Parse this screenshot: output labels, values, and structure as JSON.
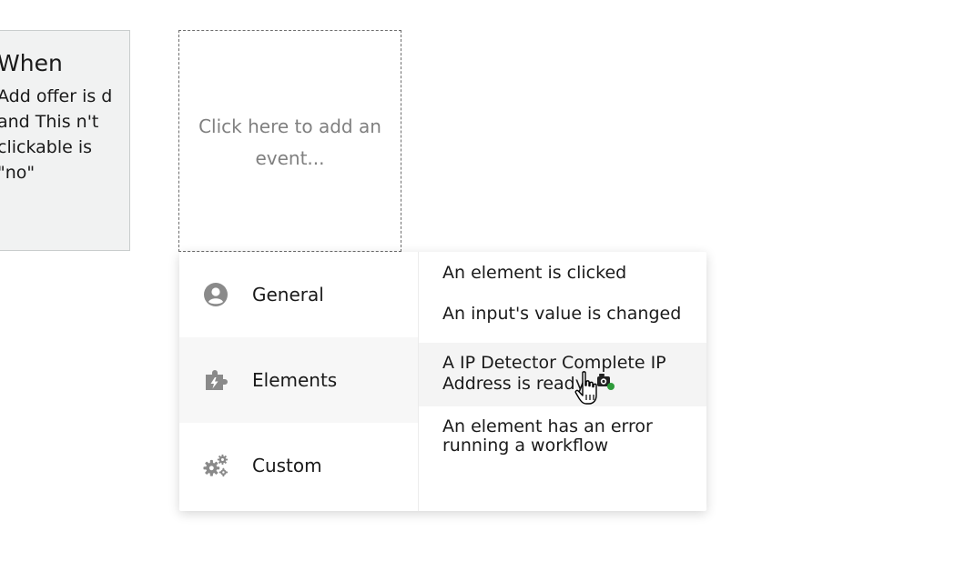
{
  "event_card": {
    "title": "When",
    "condition": "Add offer is d and This n't clickable is \"no\""
  },
  "add_event": {
    "label": "Click here to add an event..."
  },
  "menu": {
    "categories": [
      {
        "label": "General",
        "icon": "person-icon"
      },
      {
        "label": "Elements",
        "icon": "puzzle-bolt-icon"
      },
      {
        "label": "Custom",
        "icon": "gears-icon"
      }
    ],
    "active_category": "Elements",
    "events": [
      {
        "label": "An element is clicked"
      },
      {
        "label": "An input's value is changed"
      },
      {
        "label": "A IP Detector Complete IP Address is ready",
        "icon": "plugin-icon"
      },
      {
        "label": "An element has an error running a workflow"
      }
    ]
  },
  "colors": {
    "card_bg": "#f1f2f2",
    "placeholder_text": "#808080",
    "icon_gray": "#8a8a8a",
    "active_bg": "#f7f7f7"
  }
}
